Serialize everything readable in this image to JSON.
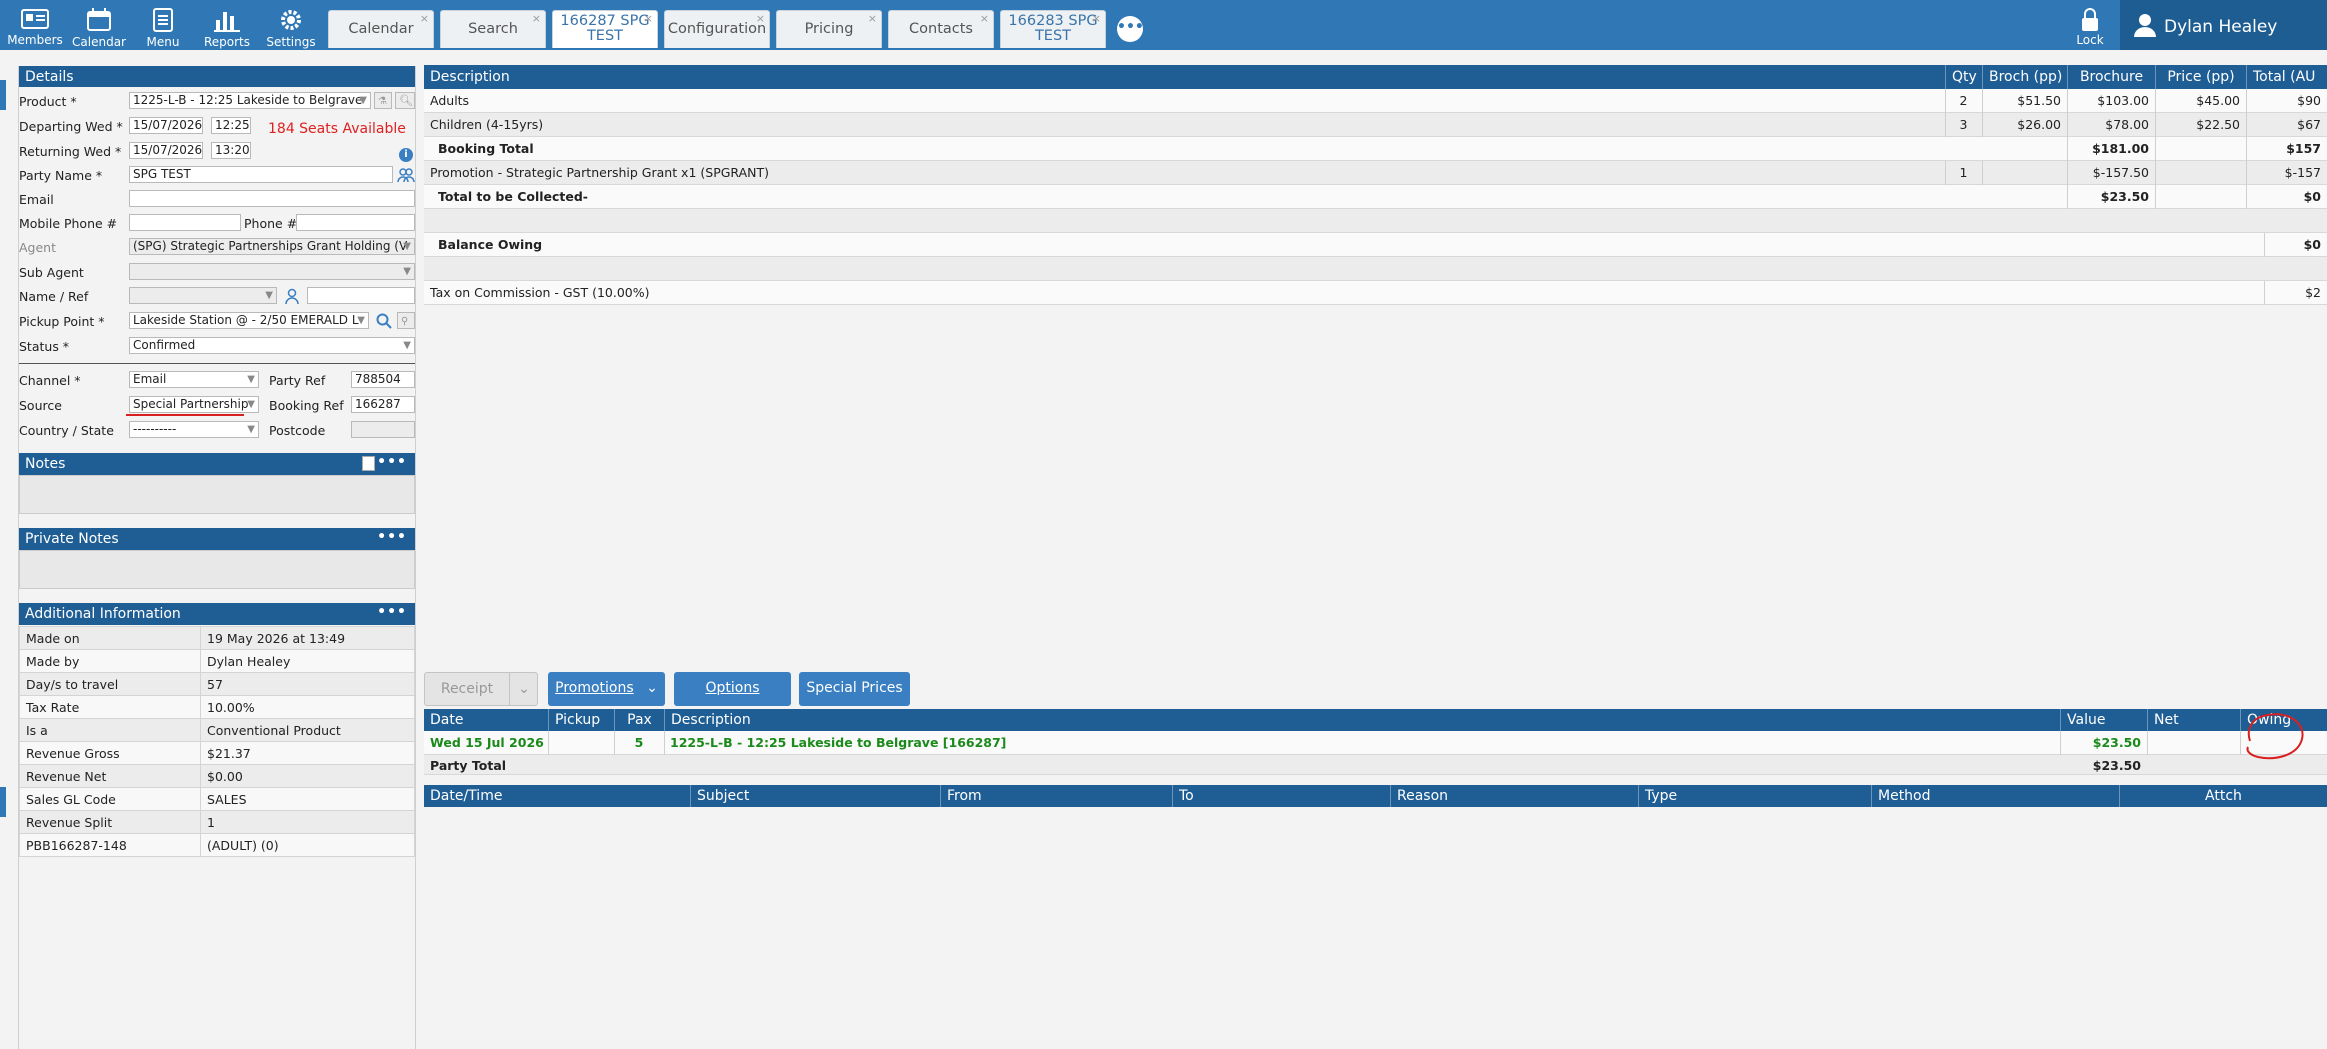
{
  "nav": {
    "items": [
      {
        "label": "Members",
        "icon": "members-icon"
      },
      {
        "label": "Calendar",
        "icon": "calendar-icon"
      },
      {
        "label": "Menu",
        "icon": "menu-icon"
      },
      {
        "label": "Reports",
        "icon": "reports-icon"
      },
      {
        "label": "Settings",
        "icon": "settings-icon"
      }
    ],
    "tabs": [
      {
        "label": "Calendar",
        "close": "×"
      },
      {
        "label": "Search",
        "close": "×"
      },
      {
        "label": "166287 SPG\nTEST",
        "close": "×"
      },
      {
        "label": "Configuration",
        "close": "×"
      },
      {
        "label": "Pricing",
        "close": "×"
      },
      {
        "label": "Contacts",
        "close": "×"
      },
      {
        "label": "166283 SPG\nTEST",
        "close": "×"
      }
    ],
    "more": "•••",
    "lock_label": "Lock",
    "user_name": "Dylan Healey"
  },
  "details": {
    "title": "Details",
    "product_label": "Product *",
    "product_value": "1225-L-B - 12:25 Lakeside to Belgrave",
    "departing_label": "Departing Wed *",
    "departing_date": "15/07/2026",
    "departing_time": "12:25",
    "seats_available": "184 Seats Available",
    "returning_label": "Returning Wed *",
    "returning_date": "15/07/2026",
    "returning_time": "13:20",
    "party_name_label": "Party Name *",
    "party_name_value": "SPG TEST",
    "email_label": "Email",
    "email_value": "",
    "mobile_label": "Mobile Phone #",
    "mobile_value": "",
    "phone_label": "Phone #",
    "phone_value": "",
    "agent_label": "Agent",
    "agent_value": "(SPG) Strategic Partnerships Grant Holding (V",
    "sub_agent_label": "Sub Agent",
    "sub_agent_value": "",
    "name_ref_label": "Name / Ref",
    "name_ref_value": "",
    "pickup_label": "Pickup Point *",
    "pickup_value": "Lakeside Station @  - 2/50 EMERALD L",
    "status_label": "Status *",
    "status_value": "Confirmed",
    "channel_label": "Channel *",
    "channel_value": "Email",
    "party_ref_label": "Party Ref",
    "party_ref_value": "788504",
    "source_label": "Source",
    "source_value": "Special Partnership",
    "booking_ref_label": "Booking Ref",
    "booking_ref_value": "166287",
    "country_label": "Country / State",
    "country_value": "----------",
    "postcode_label": "Postcode",
    "postcode_value": ""
  },
  "notes": {
    "title": "Notes",
    "dots": "•••"
  },
  "private_notes": {
    "title": "Private Notes",
    "dots": "•••"
  },
  "additional": {
    "title": "Additional Information",
    "dots": "•••",
    "rows": [
      [
        "Made on",
        "19 May 2026 at 13:49"
      ],
      [
        "Made by",
        "Dylan Healey"
      ],
      [
        "Day/s to travel",
        "57"
      ],
      [
        "Tax Rate",
        "10.00%"
      ],
      [
        "Is a",
        "Conventional Product"
      ],
      [
        "Revenue Gross",
        "$21.37"
      ],
      [
        "Revenue Net",
        "$0.00"
      ],
      [
        "Sales GL Code",
        "SALES"
      ],
      [
        "Revenue Split",
        "1"
      ],
      [
        "PBB166287-148",
        " (ADULT) (0)"
      ]
    ]
  },
  "pricing": {
    "headers": [
      "Description",
      "Qty",
      "Broch (pp)",
      "Brochure",
      "Price (pp)",
      "Total (AU"
    ],
    "rows": [
      {
        "desc": "Adults",
        "qty": "2",
        "broch_pp": "$51.50",
        "brochure": "$103.00",
        "price_pp": "$45.00",
        "total": "$90"
      },
      {
        "desc": "Children (4-15yrs)",
        "qty": "3",
        "broch_pp": "$26.00",
        "brochure": "$78.00",
        "price_pp": "$22.50",
        "total": "$67"
      },
      {
        "desc": "Booking Total",
        "qty": "",
        "broch_pp": "",
        "brochure": "$181.00",
        "price_pp": "",
        "total": "$157"
      },
      {
        "desc": "Promotion - Strategic Partnership Grant x1 (SPGRANT)",
        "qty": "1",
        "broch_pp": "",
        "brochure": "$-157.50",
        "price_pp": "",
        "total": "$-157"
      },
      {
        "desc": "Total to be Collected-",
        "qty": "",
        "broch_pp": "",
        "brochure": "$23.50",
        "price_pp": "",
        "total": "$0"
      },
      {
        "desc": "Balance Owing",
        "total": "$0"
      },
      {
        "desc": "Tax on Commission - GST (10.00%)",
        "total": "$2"
      }
    ]
  },
  "actions": {
    "receipt": "Receipt",
    "promotions": "Promotions",
    "options": "Options",
    "special_prices": "Special Prices"
  },
  "legs": {
    "headers": [
      "Date",
      "Pickup",
      "Pax",
      "Description",
      "Value",
      "Net",
      "Owing"
    ],
    "row": {
      "date": "Wed 15 Jul 2026",
      "pickup": "",
      "pax": "5",
      "desc": "1225-L-B - 12:25 Lakeside to Belgrave [166287]",
      "value": "$23.50",
      "net": "",
      "owing": ""
    },
    "total_label": "Party Total",
    "total_value": "$23.50"
  },
  "comms": {
    "headers": [
      "Date/Time",
      "Subject",
      "From",
      "To",
      "Reason",
      "Type",
      "Method",
      "Attch"
    ]
  },
  "colors": {
    "nav": "#2f78b5",
    "header": "#1f5e95",
    "accent": "#3a7fc2",
    "alert": "#e02020",
    "owing_green": "#1a8a1a",
    "annotation": "#d92020"
  }
}
